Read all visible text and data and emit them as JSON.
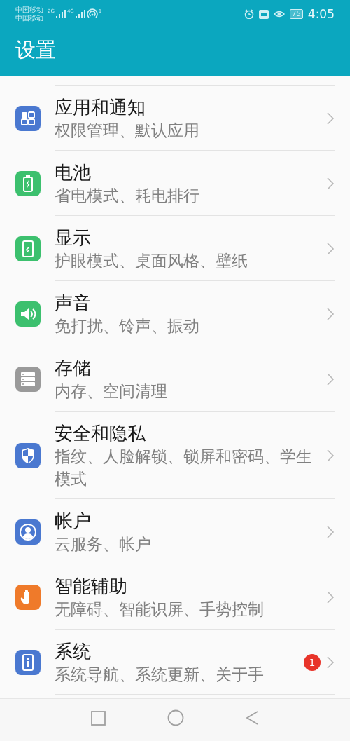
{
  "status_bar": {
    "carrier_1": "中国移动",
    "carrier_2": "中国移动",
    "network_1": "2G",
    "network_2": "4G",
    "hotspot_count": "1",
    "battery": "75",
    "time": "4:05"
  },
  "header": {
    "title": "设置"
  },
  "items": [
    {
      "title": "应用和通知",
      "subtitle": "权限管理、默认应用"
    },
    {
      "title": "电池",
      "subtitle": "省电模式、耗电排行"
    },
    {
      "title": "显示",
      "subtitle": "护眼模式、桌面风格、壁纸"
    },
    {
      "title": "声音",
      "subtitle": "免打扰、铃声、振动"
    },
    {
      "title": "存储",
      "subtitle": "内存、空间清理"
    },
    {
      "title": "安全和隐私",
      "subtitle": "指纹、人脸解锁、锁屏和密码、学生模式"
    },
    {
      "title": "帐户",
      "subtitle": "云服务、帐户"
    },
    {
      "title": "智能辅助",
      "subtitle": "无障碍、智能识屏、手势控制"
    },
    {
      "title": "系统",
      "subtitle": "系统导航、系统更新、关于手",
      "badge": "1"
    }
  ]
}
